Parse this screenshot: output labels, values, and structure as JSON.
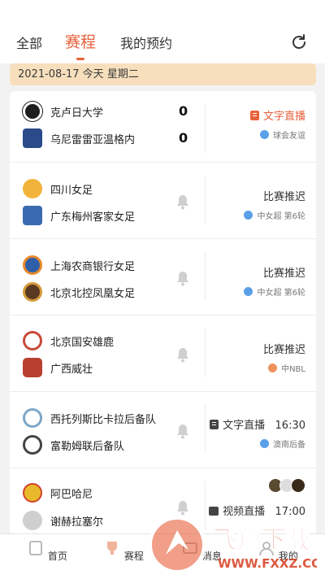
{
  "tabs": [
    "全部",
    "赛程",
    "我的预约"
  ],
  "active_tab": "赛程",
  "date_bar": "2021-08-17  今天  星期二",
  "matches": [
    {
      "home": "克卢日大学",
      "away": "乌尼雷雷亚温格内",
      "home_score": "0",
      "away_score": "0",
      "status": "文字直播",
      "league": "球会友谊",
      "home_color": "#1e1e1e",
      "away_color": "#2b4a8a"
    },
    {
      "home": "四川女足",
      "away": "广东梅州客家女足",
      "status": "比赛推迟",
      "league": "中女超 第6轮",
      "home_color": "#f2b33a",
      "away_color": "#3a6bb0"
    },
    {
      "home": "上海农商银行女足",
      "away": "北京北控凤凰女足",
      "status": "比赛推迟",
      "league": "中女超 第6轮",
      "home_color": "#2f5fa8",
      "away_color": "#d49a3a"
    },
    {
      "home": "北京国安雄鹿",
      "away": "广西威壮",
      "status": "比赛推迟",
      "league": "中NBL",
      "home_color": "#c84a3a",
      "away_color": "#b8402e"
    },
    {
      "home": "西托列斯比卡拉后备队",
      "away": "富勒姆联后备队",
      "status": "文字直播",
      "time": "16:30",
      "league": "澳南后备",
      "home_color": "#7ea7c8",
      "away_color": "#444444"
    },
    {
      "home": "阿巴哈尼",
      "away": "谢赫拉塞尔",
      "status": "视频直播",
      "time": "17:00",
      "league": "",
      "home_color": "#e8b92a",
      "away_color": "#cfcfcf"
    }
  ],
  "nav": [
    "首页",
    "赛程",
    "消息",
    "我的"
  ],
  "watermark": {
    "brand": "飞翔下载",
    "url": "WWW.FXXZ.COM"
  },
  "colors": {
    "accent": "#e8613c",
    "date_bar": "#f7dfbd"
  }
}
